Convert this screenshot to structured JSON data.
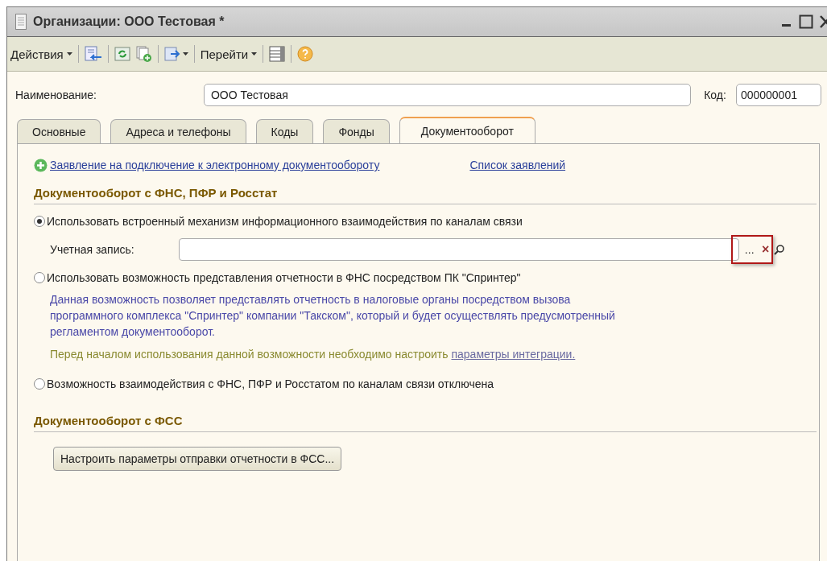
{
  "window": {
    "title": "Организации: ООО Тестовая *"
  },
  "toolbar": {
    "actions_menu": "Действия",
    "goto_menu": "Перейти"
  },
  "header": {
    "name_label": "Наименование:",
    "name_value": "ООО Тестовая",
    "code_label": "Код:",
    "code_value": "000000001"
  },
  "tabs": [
    {
      "label": "Основные",
      "selected": false
    },
    {
      "label": "Адреса и телефоны",
      "selected": false
    },
    {
      "label": "Коды",
      "selected": false
    },
    {
      "label": "Фонды",
      "selected": false
    },
    {
      "label": "Документооборот",
      "selected": true
    }
  ],
  "links": {
    "new_application": "Заявление на подключение к электронному документообороту",
    "applications_list": "Список заявлений"
  },
  "section_fns": {
    "title": "Документооборот с ФНС, ПФР и Росстат",
    "options": [
      {
        "kind": "account",
        "label": "Использовать встроенный механизм информационного взаимодействия по каналам связи",
        "selected": true,
        "field_label": "Учетная запись:",
        "field_buttons": [
          "...",
          "×"
        ]
      },
      {
        "kind": "sprinter",
        "label": "Использовать возможность представления отчетности в ФНС посредством ПК \"Спринтер\"",
        "selected": false,
        "description": "Данная возможность позволяет представлять отчетность в налоговые органы посредством вызова программного комплекса \"Спринтер\" компании \"Такском\", который и будет осуществлять предусмотренный регламентом документооборот.",
        "note": "Перед началом использования данной возможности необходимо настроить",
        "note_link": "параметры интеграции."
      },
      {
        "kind": "plain",
        "label": "Возможность взаимодействия с ФНС, ПФР и Росстатом по каналам связи отключена",
        "selected": false
      }
    ]
  },
  "section_fss": {
    "title": "Документооборот с ФСС",
    "button": "Настроить параметры отправки отчетности в ФСС..."
  }
}
